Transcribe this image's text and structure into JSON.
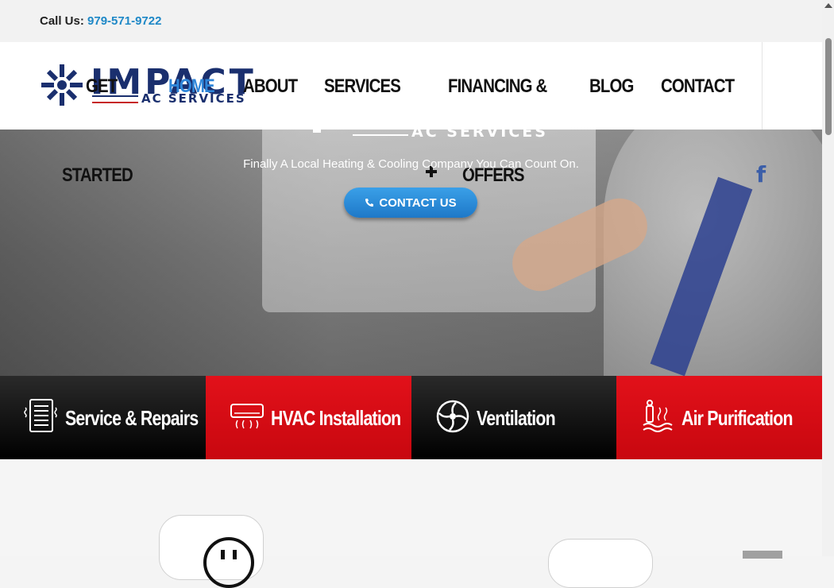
{
  "topbar": {
    "call_label": "Call Us:",
    "phone": "979-571-9722"
  },
  "logo": {
    "name": "IMPACT",
    "sub": "AC SERVICES"
  },
  "nav": {
    "get": "GET",
    "started": "STARTED",
    "home": "HOME",
    "about": "ABOUT",
    "services": "SERVICES",
    "financing": "FINANCING &",
    "offers": "OFFERS",
    "blog": "BLOG",
    "contact": "CONTACT"
  },
  "hero": {
    "logo_sub": "AC SERVICES",
    "tagline": "Finally A Local Heating & Cooling Company You Can Count On.",
    "button_label": "CONTACT US",
    "facebook": "f"
  },
  "services": [
    {
      "label": "Service & Repairs",
      "icon": "furnace-icon"
    },
    {
      "label": "HVAC Installation",
      "icon": "ac-unit-icon"
    },
    {
      "label": "Ventilation",
      "icon": "fan-icon"
    },
    {
      "label": "Air Purification",
      "icon": "air-purifier-icon"
    }
  ],
  "colors": {
    "accent": "#1e88c7",
    "red": "#e2111a",
    "navy": "#1a2f6e"
  }
}
